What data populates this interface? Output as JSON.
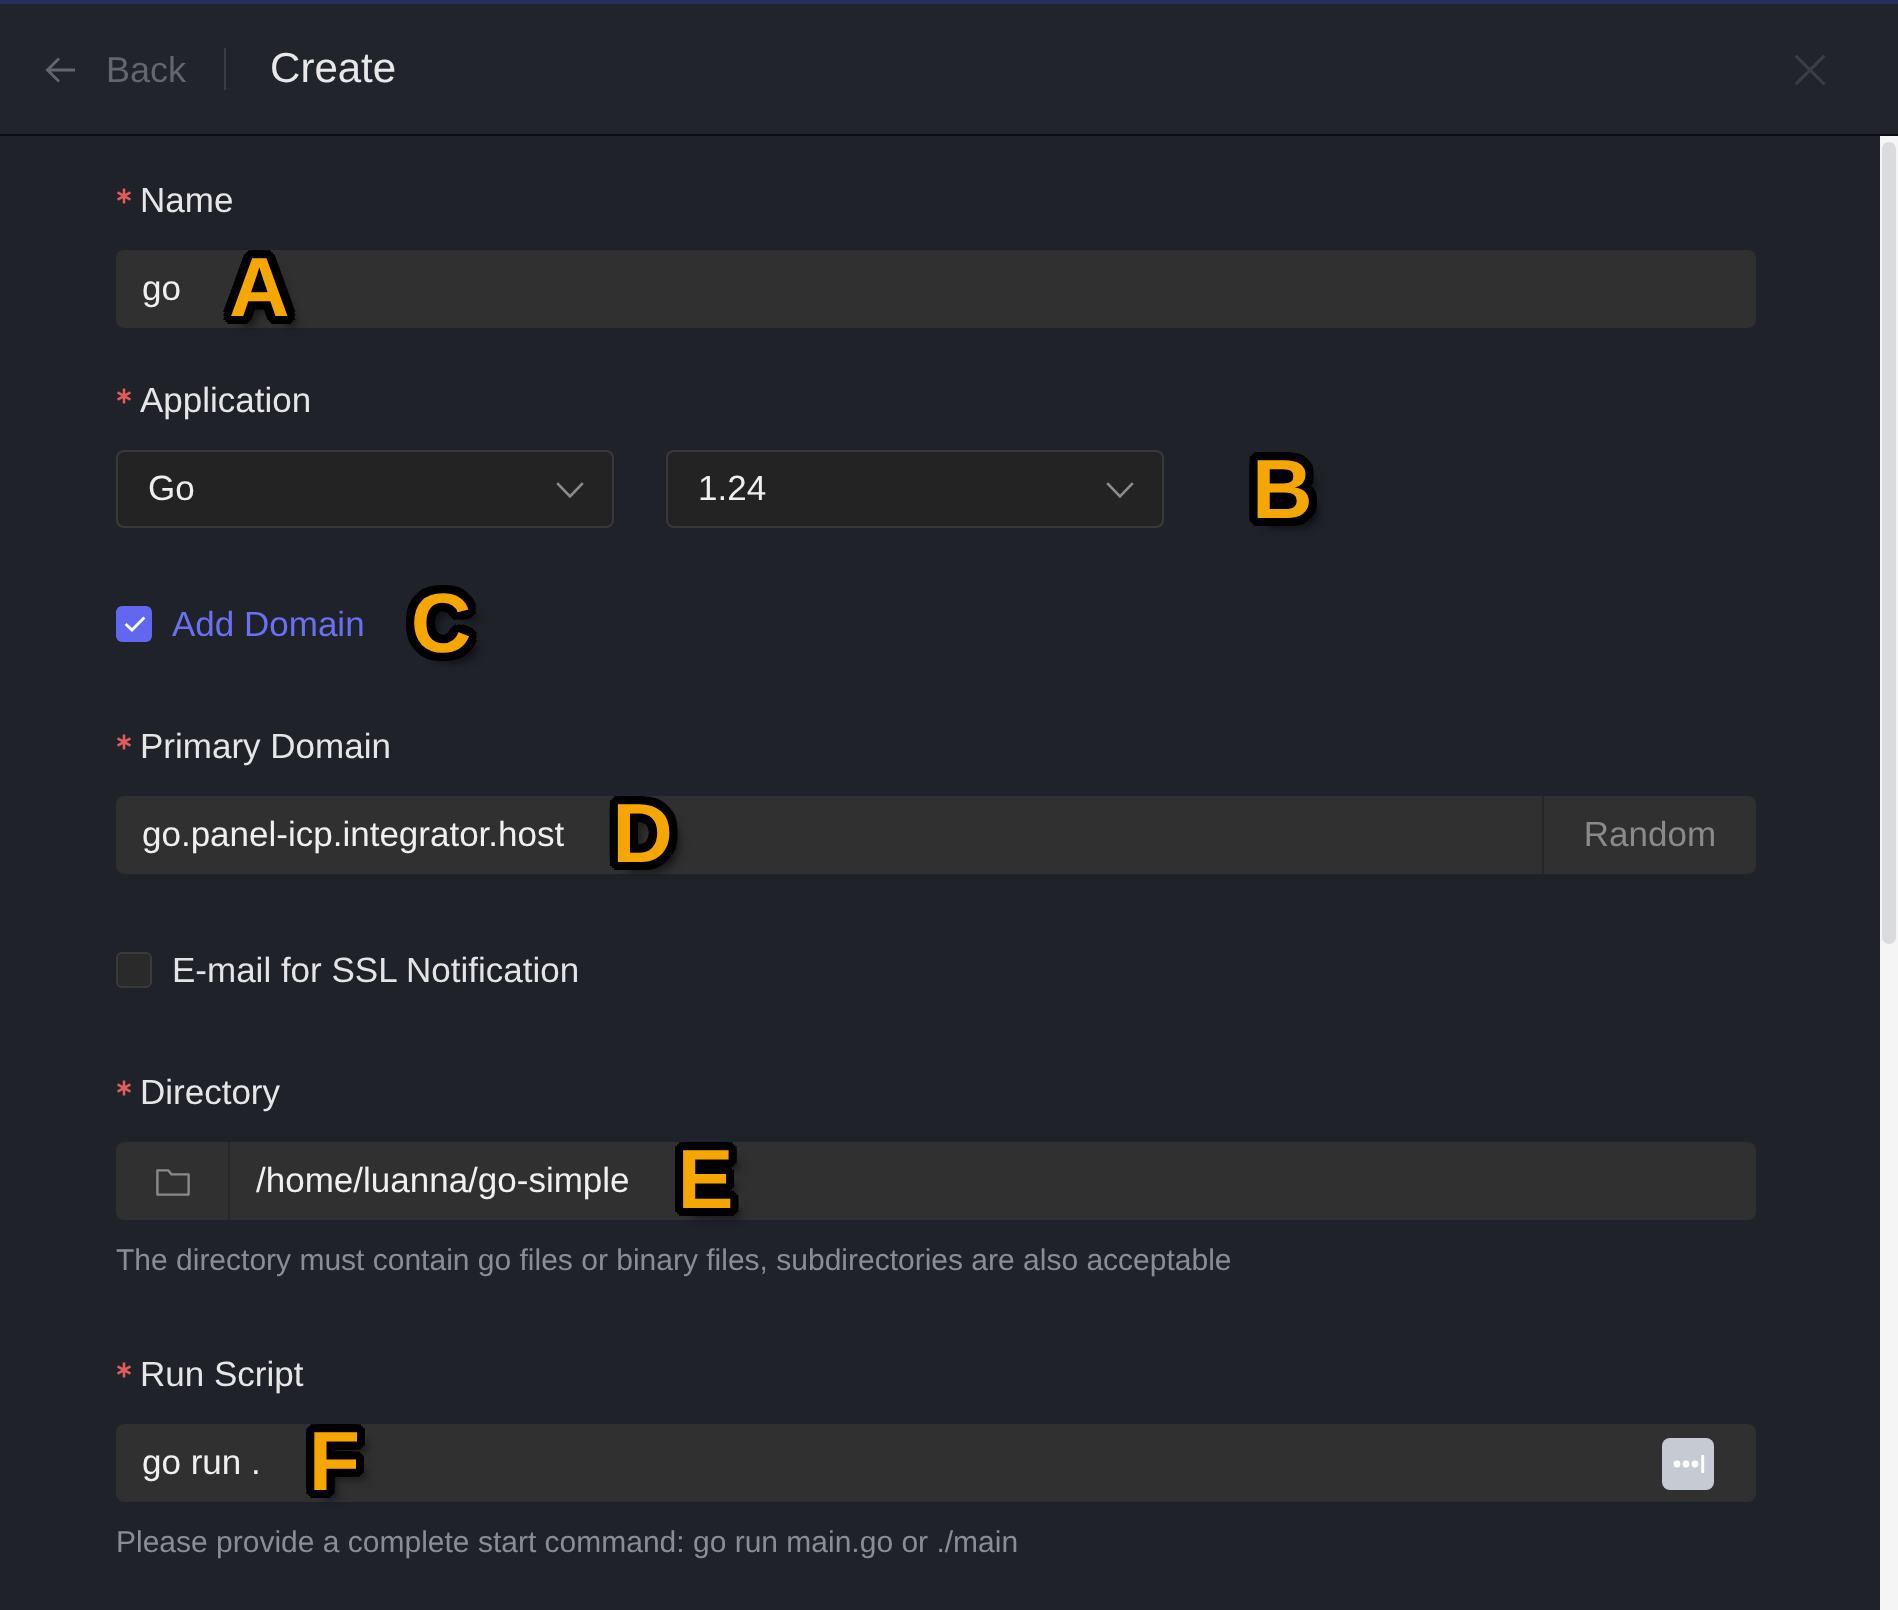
{
  "header": {
    "back": {
      "label": "Back",
      "disabled": true
    },
    "title": "Create"
  },
  "fields": [
    {
      "kind": "text",
      "label": "Name",
      "required": true,
      "value": "go",
      "callout": "A"
    },
    {
      "kind": "select",
      "label": "Application",
      "required": true,
      "selects": [
        {
          "value": "Go"
        },
        {
          "value": "1.24"
        }
      ],
      "callout": "B"
    },
    {
      "kind": "checkbox",
      "label": "Add Domain",
      "checked": true,
      "callout": "C"
    },
    {
      "kind": "text",
      "label": "Primary Domain",
      "required": true,
      "value": "go.panel-icp.integrator.host",
      "addon": "Random",
      "callout": "D"
    },
    {
      "kind": "checkbox",
      "label": "E-mail for SSL Notification",
      "checked": false
    },
    {
      "kind": "path",
      "label": "Directory",
      "required": true,
      "value": "/home/luanna/go-simple",
      "help": "The directory must contain go files or binary files, subdirectories are also acceptable",
      "callout": "E"
    },
    {
      "kind": "script",
      "label": "Run Script",
      "required": true,
      "value": "go run .",
      "help": "Please provide a complete start command: go run main.go or ./main",
      "callout": "F"
    }
  ]
}
